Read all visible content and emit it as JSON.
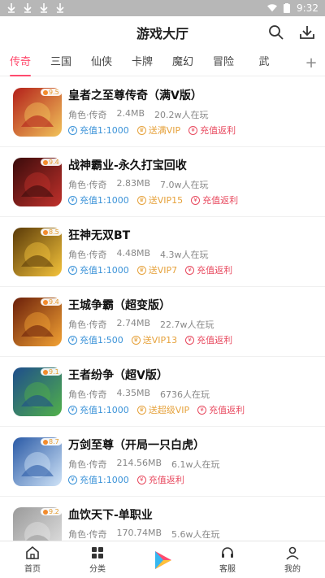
{
  "statusbar": {
    "time": "9:32"
  },
  "appbar": {
    "title": "游戏大厅"
  },
  "tabs": [
    "传奇",
    "三国",
    "仙侠",
    "卡牌",
    "魔幻",
    "冒险",
    "武"
  ],
  "games": [
    {
      "name": "皇者之至尊传奇（满V版）",
      "score": "9.5",
      "category": "角色·传奇",
      "size": "2.4MB",
      "players": "20.2w人在玩",
      "badges": [
        {
          "text": "充值1:1000",
          "style": "blue"
        },
        {
          "text": "送满VIP",
          "style": "gold"
        },
        {
          "text": "充值返利",
          "style": "red"
        }
      ],
      "icon_colors": [
        "#b3201a",
        "#f1c35a"
      ]
    },
    {
      "name": "战神霸业-永久打宝回收",
      "score": "9.4",
      "category": "角色·传奇",
      "size": "2.83MB",
      "players": "7.0w人在玩",
      "badges": [
        {
          "text": "充值1:1000",
          "style": "blue"
        },
        {
          "text": "送VIP15",
          "style": "gold"
        },
        {
          "text": "充值返利",
          "style": "red"
        }
      ],
      "icon_colors": [
        "#3a0b0b",
        "#c0312b"
      ]
    },
    {
      "name": "狂神无双BT",
      "score": "8.5",
      "category": "角色·传奇",
      "size": "4.48MB",
      "players": "4.3w人在玩",
      "badges": [
        {
          "text": "充值1:1000",
          "style": "blue"
        },
        {
          "text": "送VIP7",
          "style": "gold"
        },
        {
          "text": "充值返利",
          "style": "red"
        }
      ],
      "icon_colors": [
        "#5a3a08",
        "#f4c33b"
      ]
    },
    {
      "name": "王城争霸（超变版）",
      "score": "9.4",
      "category": "角色·传奇",
      "size": "2.74MB",
      "players": "22.7w人在玩",
      "badges": [
        {
          "text": "充值1:500",
          "style": "blue"
        },
        {
          "text": "送VIP13",
          "style": "gold"
        },
        {
          "text": "充值返利",
          "style": "red"
        }
      ],
      "icon_colors": [
        "#6b1f0a",
        "#f2a234"
      ]
    },
    {
      "name": "王者纷争（超V版）",
      "score": "9.1",
      "category": "角色·传奇",
      "size": "4.35MB",
      "players": "6736人在玩",
      "badges": [
        {
          "text": "充值1:1000",
          "style": "blue"
        },
        {
          "text": "送超级VIP",
          "style": "gold"
        },
        {
          "text": "充值返利",
          "style": "red"
        }
      ],
      "icon_colors": [
        "#1e4d8c",
        "#51b04a"
      ]
    },
    {
      "name": "万剑至尊（开局一只白虎）",
      "score": "8.7",
      "category": "角色·传奇",
      "size": "214.56MB",
      "players": "6.1w人在玩",
      "badges": [
        {
          "text": "充值1:1000",
          "style": "blue"
        },
        {
          "text": "充值返利",
          "style": "red"
        }
      ],
      "icon_colors": [
        "#2a5aa6",
        "#cfe3f7"
      ]
    },
    {
      "name": "血饮天下-单职业",
      "score": "9.2",
      "category": "角色·传奇",
      "size": "170.74MB",
      "players": "5.6w人在玩",
      "badges": [],
      "icon_colors": [
        "#9a9a9a",
        "#e5e5e5"
      ]
    }
  ],
  "bottomnav": [
    {
      "label": "首页",
      "icon": "home-icon"
    },
    {
      "label": "分类",
      "icon": "grid-icon"
    },
    {
      "label": "",
      "icon": "play-logo-icon"
    },
    {
      "label": "客服",
      "icon": "headset-icon"
    },
    {
      "label": "我的",
      "icon": "user-icon"
    }
  ]
}
